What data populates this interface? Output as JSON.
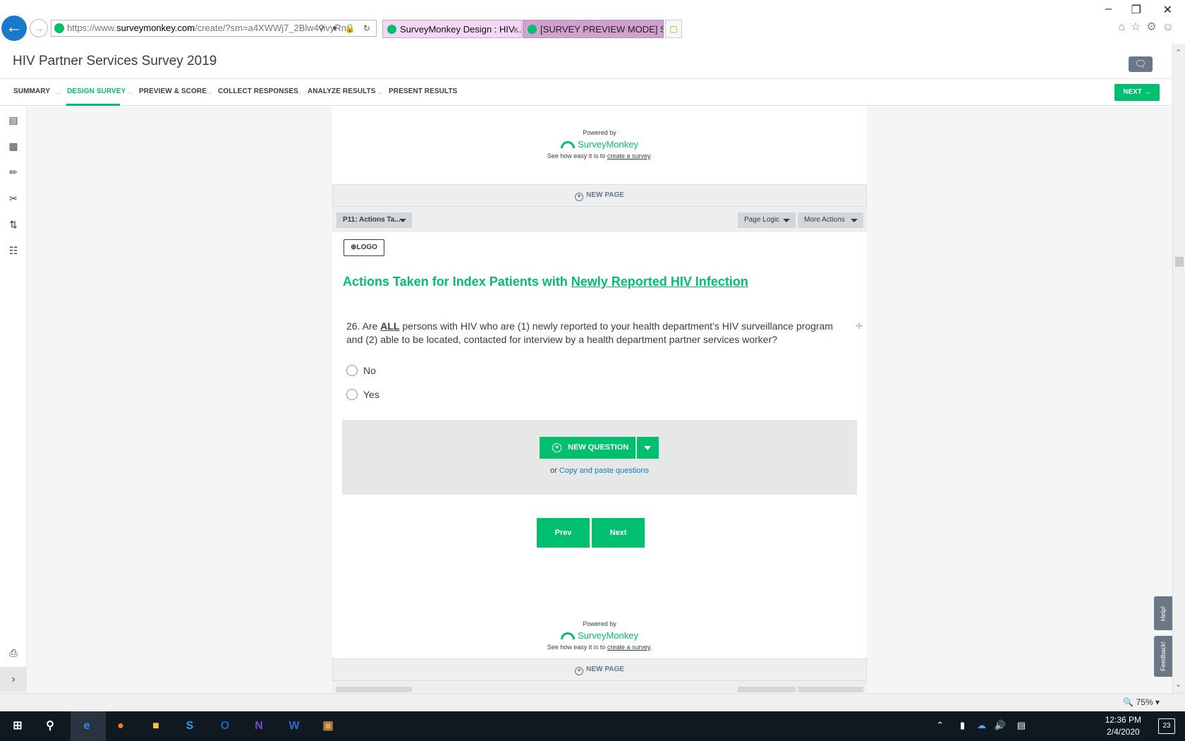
{
  "browser": {
    "url_prefix": "https://www.",
    "url_domain": "surveymonkey.com",
    "url_path": "/create/?sm=a4XWWj7_2Blw4vivyRn(",
    "tabs": [
      {
        "label": "SurveyMonkey Design : HIV..."
      },
      {
        "label": "[SURVEY PREVIEW MODE] Surv..."
      }
    ],
    "tab_close": "×",
    "zoom": "75%"
  },
  "app": {
    "title": "HIV Partner Services Survey 2019",
    "nav": [
      {
        "label": "SUMMARY"
      },
      {
        "label": "DESIGN SURVEY"
      },
      {
        "label": "PREVIEW & SCORE"
      },
      {
        "label": "COLLECT RESPONSES"
      },
      {
        "label": "ANALYZE RESULTS"
      },
      {
        "label": "PRESENT RESULTS"
      }
    ],
    "next_label": "NEXT"
  },
  "footer_branding": {
    "powered_by": "Powered by",
    "brand": "SurveyMonkey",
    "see_how": "See how easy it is to",
    "create_link": "create a survey",
    "period": "."
  },
  "page_actions": {
    "new_page": "NEW PAGE",
    "page_select": "P11: Actions Ta...",
    "page_logic": "Page Logic",
    "more_actions": "More Actions",
    "logo": "LOGO"
  },
  "page": {
    "title_plain": "Actions Taken for Index Patients with ",
    "title_underlined": "Newly Reported HIV Infection",
    "question": {
      "number_prefix": "26. Are ",
      "emphasis": "ALL",
      "text": " persons with HIV who are (1) newly reported to your health department’s HIV surveillance program and (2) able to be located, contacted for interview by a health department partner services worker?",
      "options": [
        {
          "label": "No"
        },
        {
          "label": "Yes"
        }
      ]
    },
    "new_question": "NEW QUESTION",
    "or": "or",
    "copy_paste": "Copy and paste questions",
    "prev": "Prev",
    "next": "Next"
  },
  "side_tabs": {
    "help": "Help!",
    "feedback": "Feedback!"
  },
  "taskbar": {
    "time": "12:36 PM",
    "date": "2/4/2020",
    "notifications": "23"
  },
  "colors": {
    "accent": "#00bf6f",
    "link": "#1979ca",
    "text": "#333e48"
  }
}
